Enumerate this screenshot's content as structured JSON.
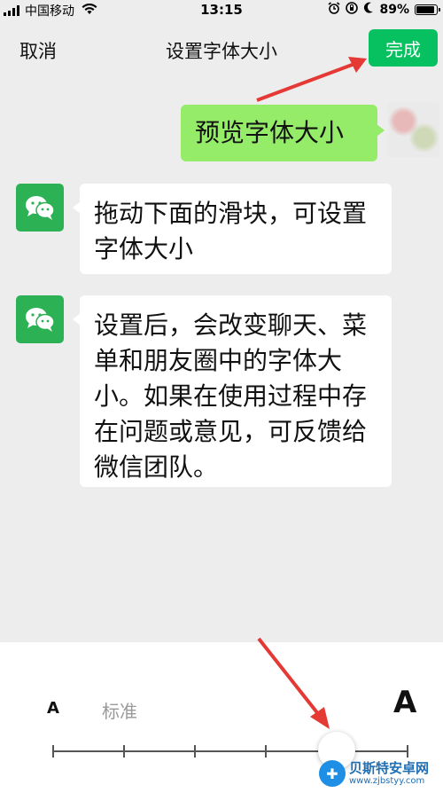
{
  "status_bar": {
    "carrier": "中国移动",
    "time": "13:15",
    "battery_percent": "89%",
    "battery_level": 0.89,
    "icons": [
      "signal-icon",
      "wifi-icon",
      "alarm-icon",
      "orientation-lock-icon",
      "moon-icon",
      "battery-icon"
    ]
  },
  "nav": {
    "cancel_label": "取消",
    "title": "设置字体大小",
    "done_label": "完成"
  },
  "messages": {
    "preview": "预览字体大小",
    "msg1": "拖动下面的滑块，可设置字体大小",
    "msg2": "设置后，会改变聊天、菜单和朋友圈中的字体大小。如果在使用过程中存在问题或意见，可反馈给微信团队。"
  },
  "font_slider": {
    "small_label": "A",
    "standard_label": "标准",
    "large_label": "A",
    "tick_count": 6,
    "selected_index": 4
  },
  "watermark": {
    "title": "贝斯特安卓网",
    "url": "www.zjbstyy.com"
  },
  "colors": {
    "accent": "#07c160",
    "bubble_green": "#95ec69",
    "background": "#ededed",
    "annotation_arrow": "#e53935"
  }
}
